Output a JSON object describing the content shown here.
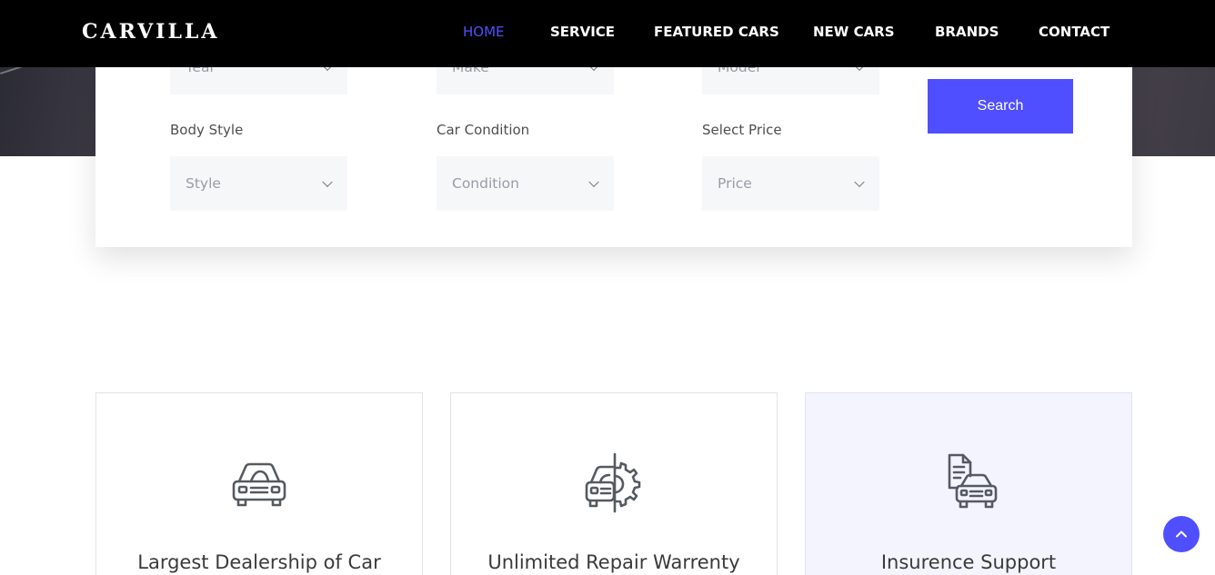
{
  "header": {
    "logo": "CARVILLA",
    "nav": [
      {
        "label": "HOME",
        "active": true
      },
      {
        "label": "SERVICE",
        "active": false
      },
      {
        "label": "FEATURED CARS",
        "active": false
      },
      {
        "label": "NEW CARS",
        "active": false
      },
      {
        "label": "BRANDS",
        "active": false
      },
      {
        "label": "CONTACT",
        "active": false
      }
    ]
  },
  "search": {
    "top_selects": [
      "Year",
      "Make",
      "Model"
    ],
    "fields": [
      {
        "label": "Body Style",
        "value": "Style"
      },
      {
        "label": "Car Condition",
        "value": "Condition"
      },
      {
        "label": "Select Price",
        "value": "Price"
      }
    ],
    "button_label": "Search"
  },
  "features": [
    {
      "title": "Largest Dealership of Car",
      "icon": "car-icon"
    },
    {
      "title": "Unlimited Repair Warrenty",
      "icon": "car-repair-gear-icon"
    },
    {
      "title": "Insurence Support",
      "icon": "car-document-icon"
    }
  ],
  "colors": {
    "accent": "#4f4fff",
    "header_bg": "#000000",
    "select_bg": "#f6f7f9",
    "highlight_card_bg": "#f4f4fe"
  }
}
